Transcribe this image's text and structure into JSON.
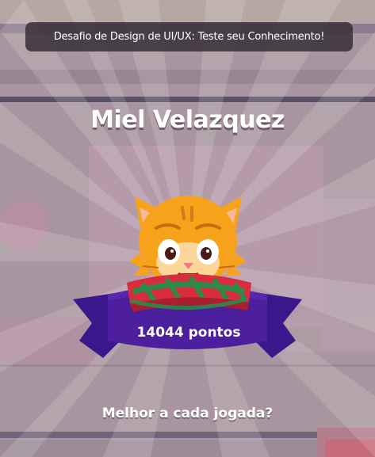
{
  "banner": {
    "title": "Desafio de Design de UI/UX: Teste seu Conhecimento!"
  },
  "player": {
    "name": "Miel Velazquez",
    "score_label": "14044 pontos",
    "mascot_icon": "cat-with-scarf-icon"
  },
  "footer": {
    "tagline": "Melhor a cada jogada?"
  },
  "colors": {
    "ribbon": "#4b1f9e",
    "ribbon_dark": "#2f1170",
    "cat": "#f7a21b",
    "scarf_red": "#d92c3c",
    "scarf_green": "#2e8a4a",
    "overlay": "#a7959f"
  }
}
